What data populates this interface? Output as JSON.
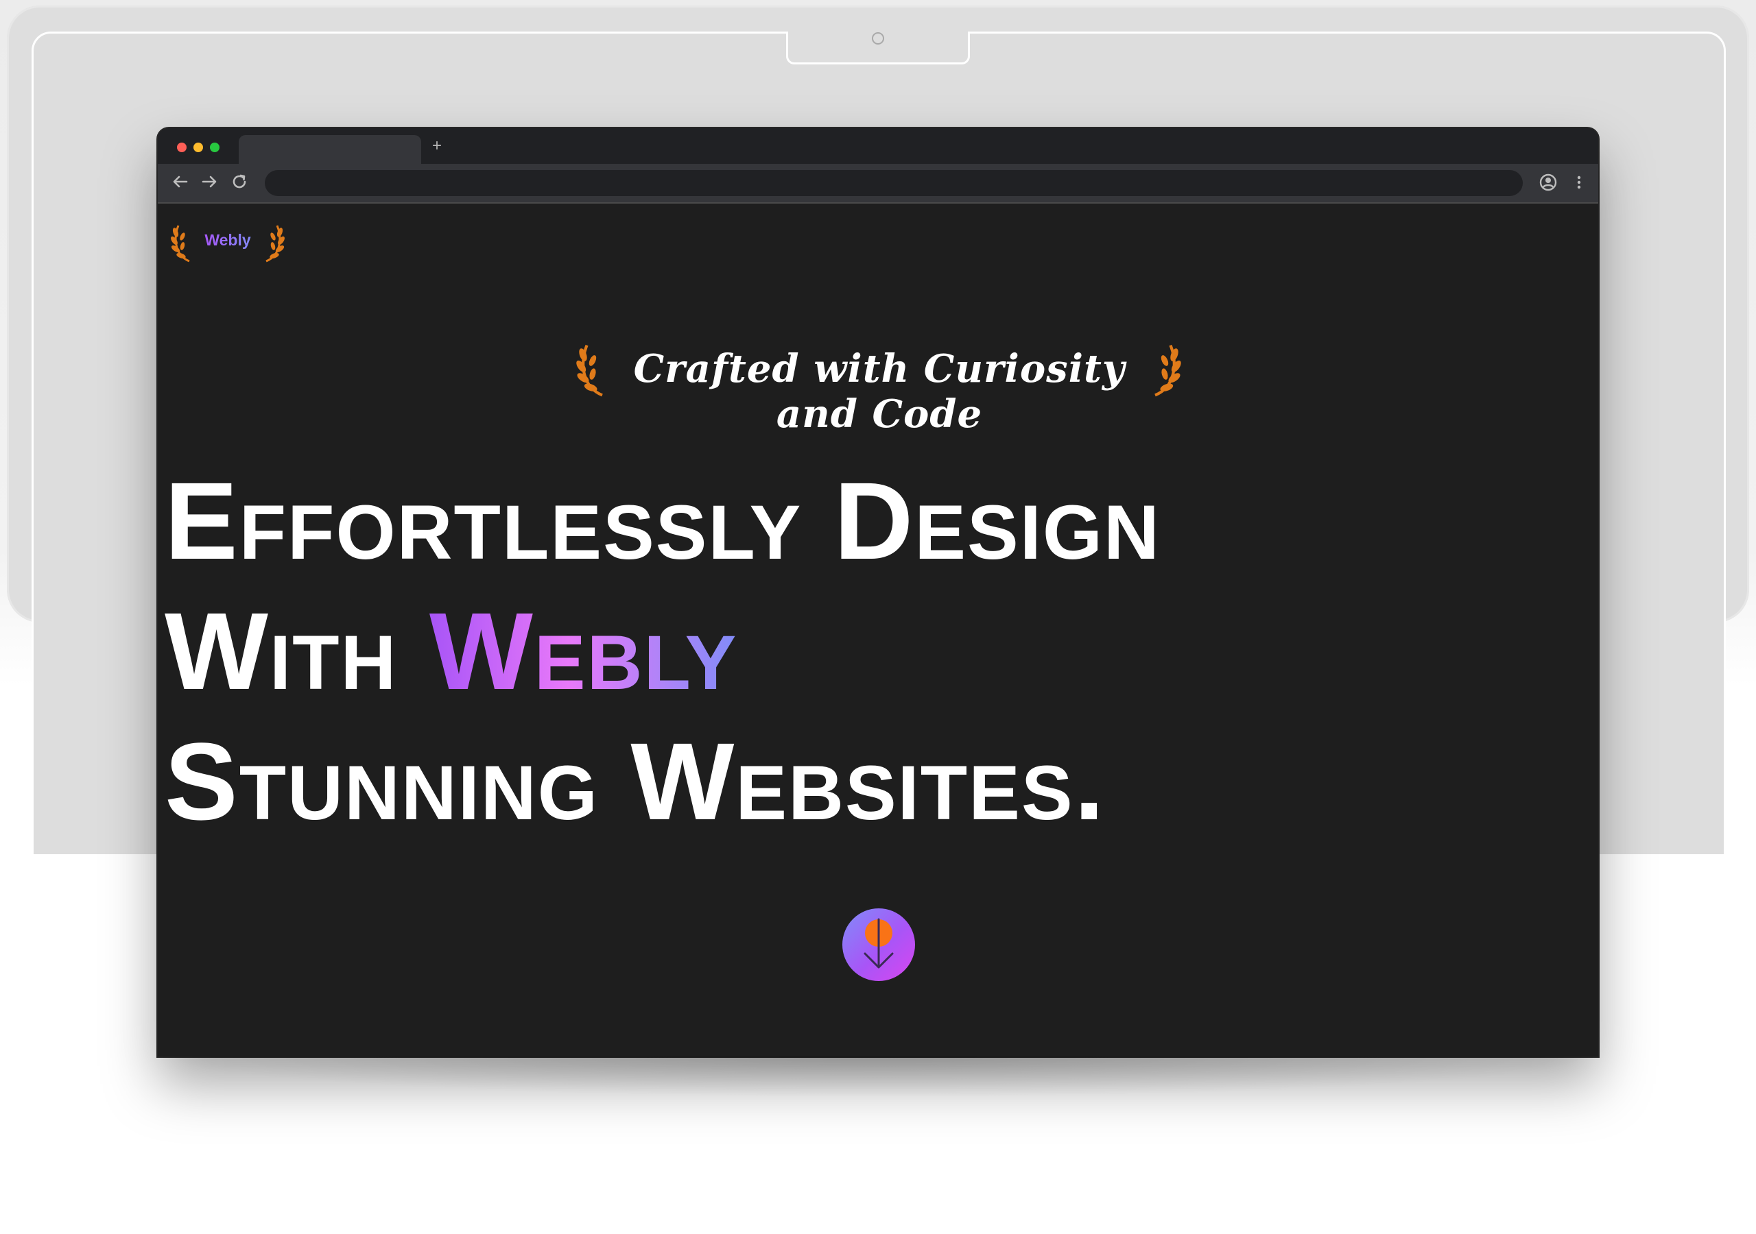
{
  "browser": {
    "new_tab_label": "+",
    "back_icon": "arrow-left-icon",
    "forward_icon": "arrow-right-icon",
    "reload_icon": "reload-icon",
    "profile_icon": "profile-icon",
    "menu_icon": "more-vertical-icon",
    "address_value": ""
  },
  "site": {
    "brand": "Webly",
    "tagline": "Crafted with Curiosity and Code",
    "headline": {
      "line1": "Effortlessly Design",
      "line2_prefix": "With",
      "line2_highlight": "Webly",
      "line3": "Stunning Websites."
    },
    "scroll_icon": "arrow-down-icon"
  },
  "colors": {
    "page_background": "#1e1e1e",
    "gradient_start": "#a855f7",
    "gradient_mid": "#e879f9",
    "gradient_end": "#818cf8",
    "wreath": "#e07b1a",
    "accent_orange": "#f97316"
  }
}
